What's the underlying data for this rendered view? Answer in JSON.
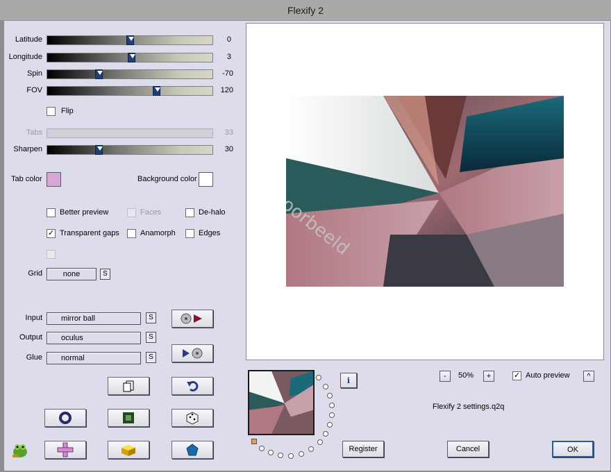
{
  "window": {
    "title": "Flexify 2"
  },
  "sliders": {
    "latitude": {
      "label": "Latitude",
      "value": "0",
      "fraction": 0.5
    },
    "longitude": {
      "label": "Longitude",
      "value": "3",
      "fraction": 0.51
    },
    "spin": {
      "label": "Spin",
      "value": "-70",
      "fraction": 0.31
    },
    "fov": {
      "label": "FOV",
      "value": "120",
      "fraction": 0.67
    },
    "tabs": {
      "label": "Tabs",
      "value": "33"
    },
    "sharpen": {
      "label": "Sharpen",
      "value": "30",
      "fraction": 0.31
    }
  },
  "flip": {
    "label": "Flip",
    "checked": false
  },
  "colors": {
    "tab_color_label": "Tab color",
    "tab_color": "#d9a6d8",
    "background_color_label": "Background color",
    "background_color": "#ffffff"
  },
  "options": {
    "better_preview": {
      "label": "Better preview",
      "checked": false
    },
    "faces": {
      "label": "Faces",
      "checked": false
    },
    "de_halo": {
      "label": "De-halo",
      "checked": false
    },
    "transparent_gaps": {
      "label": "Transparent gaps",
      "checked": true
    },
    "anamorph": {
      "label": "Anamorph",
      "checked": false
    },
    "edges": {
      "label": "Edges",
      "checked": false
    }
  },
  "grid": {
    "label": "Grid",
    "value": "none"
  },
  "input": {
    "label": "Input",
    "value": "mirror ball"
  },
  "output": {
    "label": "Output",
    "value": "oculus"
  },
  "glue": {
    "label": "Glue",
    "value": "normal"
  },
  "s_label": "S",
  "zoom": {
    "minus": "-",
    "value": "50%",
    "plus": "+"
  },
  "auto_preview": {
    "label": "Auto preview",
    "checked": true,
    "arrow": "^"
  },
  "settings_file": "Flexify 2 settings.q2q",
  "buttons": {
    "register": "Register",
    "cancel": "Cancel",
    "ok": "OK"
  },
  "info_label": "i",
  "check_mark": "✓",
  "icons": [
    "copy-icon",
    "undo-icon",
    "circle-icon",
    "square-icon",
    "dice-icon",
    "frog-logo-icon",
    "cross-icon",
    "cube-icon",
    "pentagon-icon",
    "disc-play-icon",
    "play-disc-icon"
  ]
}
